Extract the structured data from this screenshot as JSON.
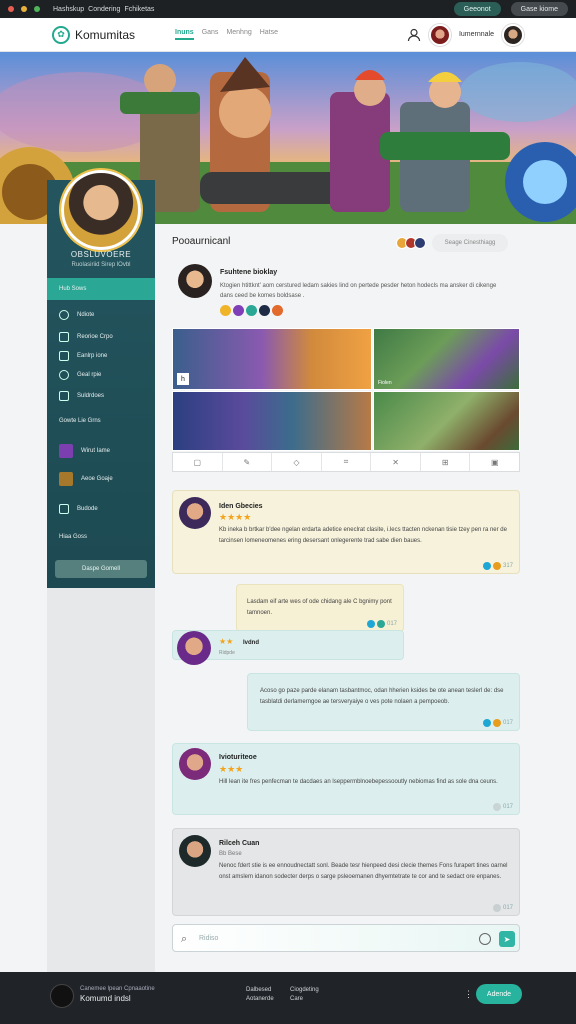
{
  "system_bar": {
    "items": [
      "Hashskup",
      "Condering",
      "Fchiketas"
    ],
    "pill1": "Geeonot",
    "pill2": "Gase kiome"
  },
  "nav": {
    "logo": "Komumitas",
    "links": [
      "Inuns",
      "Gans",
      "Menhng",
      "Hatse"
    ],
    "user_label": "Iumernnale"
  },
  "sidebar": {
    "name": "OBSLUVOERE",
    "subtitle": "Ruolasiriid Sirep lOvbl",
    "section_header": "Hub Sows",
    "items": [
      "Ndiote",
      "Reorioe Crpo",
      "Eanlrp ione",
      "Geal rpie",
      "Suldrdoes"
    ],
    "section2": "Gowte Lie Grns",
    "games": [
      "Wirut Iame",
      "Aeoe Goaje",
      "Budode"
    ],
    "section3": "Hiaa Goss",
    "button": "Daspe Gomell"
  },
  "main": {
    "title": "Pooaurnicanl",
    "action_button": "Seage Cinesthiagg"
  },
  "post": {
    "author": "Fsuhtene bioklay",
    "text": "Ktogien htittknt' aom cerstured ledam sakies lind on pertede pesder heton hodecls ma ansker di cikenge dans ceed be komes boldsase .",
    "gallery_label": "Fiolen"
  },
  "comments": [
    {
      "name": "Iden Gbecies",
      "stars": "★★★★",
      "text": "Kb ineka b brtkar b'dee ngelan erdarta adetice eneclrat clasite, i.lecs ttacten nckenan tisie tzey pen ra ner de tarcinsen lomeneomenes ering desersant onlegerente trad sabe dien baues.",
      "meta": "317"
    },
    {
      "name": "",
      "stars": "",
      "text": "Lasdam eif arte wes of ode chidang ale C bgnimy pont tamnoen.",
      "meta": "017"
    },
    {
      "name": "Ivdnd",
      "stars": "★★",
      "text": "",
      "meta": "Ridpde"
    },
    {
      "name": "",
      "stars": "",
      "text": "Acoso go paze parde elanam tasbantmoc, odan hherien ksides be ote anean teslerl de: dse tasblatdi derlamerngoe ae tersveryaiye o ves pote nolaen a pempoeob.",
      "meta": "017"
    },
    {
      "name": "Ivioturiteoe",
      "stars": "★★★",
      "text": "Hill lean ite fres penfecman te dacdaes an lseppermblnoebepessooutly nebiomas find as sole dna ceuns.",
      "meta": "017"
    },
    {
      "name": "Rilceh Cuan",
      "stars": "",
      "sub": "Bb Bese",
      "text": "Nenoc fdert stie is ee ennoudnectatt sonl. Beade tesr hienpeed desi clecie themes Fons furapert tines oarnel onst amslem idanon sodecter derps o sarge psleoemanen dhyemtetrate te cor and te sedact ore enpanes.",
      "meta": "017"
    }
  ],
  "composer": {
    "placeholder": "Ridiso"
  },
  "footer": {
    "tagline": "Canemee lpean Cpnaaotine",
    "name": "Komumd indsl",
    "col1": [
      "Dalbesed",
      "Aotanerde"
    ],
    "col2": [
      "Ciogdeting",
      "Care"
    ],
    "button": "Adende"
  }
}
